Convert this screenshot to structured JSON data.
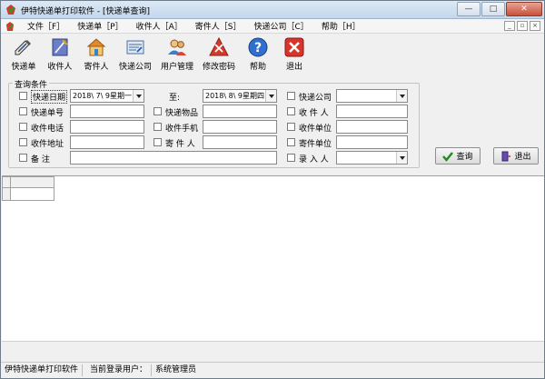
{
  "window": {
    "title": "伊特快递单打印软件 - [快递单查询]",
    "controls": [
      "—",
      "□",
      "✕"
    ]
  },
  "menu": {
    "items": [
      "文件［F］",
      "快递单［P］",
      "收件人［A］",
      "寄件人［S］",
      "快递公司［C］",
      "帮助［H］"
    ],
    "mdi_controls": [
      "_",
      "▫",
      "×"
    ]
  },
  "toolbar": {
    "items": [
      {
        "label": "快递单",
        "icon": "express-bill-icon"
      },
      {
        "label": "收件人",
        "icon": "recipient-icon"
      },
      {
        "label": "寄件人",
        "icon": "sender-house-icon"
      },
      {
        "label": "快递公司",
        "icon": "courier-company-icon"
      },
      {
        "label": "用户管理",
        "icon": "user-management-icon"
      },
      {
        "label": "修改密码",
        "icon": "change-password-icon"
      },
      {
        "label": "帮助",
        "icon": "help-icon"
      },
      {
        "label": "退出",
        "icon": "exit-icon"
      }
    ]
  },
  "query": {
    "group_title": "查询条件",
    "date_label": "快递日期",
    "date_from": "2018\\ 7\\ 9星期一",
    "to_label": "至:",
    "date_to": "2018\\ 8\\ 9星期四",
    "courier_label": "快递公司",
    "courier_value": "",
    "bill_no_label": "快递单号",
    "bill_no_value": "",
    "goods_label": "快递物品",
    "goods_value": "",
    "recipient_label": "收 件 人",
    "recipient_value": "",
    "recv_phone_label": "收件电话",
    "recv_phone_value": "",
    "recv_mobile_label": "收件手机",
    "recv_mobile_value": "",
    "recv_unit_label": "收件单位",
    "recv_unit_value": "",
    "recv_addr_label": "收件地址",
    "recv_addr_value": "",
    "sender_label": "寄 件 人",
    "sender_value": "",
    "send_unit_label": "寄件单位",
    "send_unit_value": "",
    "remark_label": "备    注",
    "remark_value": "",
    "entered_by_label": "录 入 人",
    "entered_by_value": ""
  },
  "buttons": {
    "search": "查询",
    "exit": "退出"
  },
  "status": {
    "app_name": "伊特快递单打印软件",
    "user_label": "当前登录用户：",
    "user_name": "系统管理员"
  },
  "colors": {
    "accent_red": "#c8503a",
    "check_green": "#1e8a1e"
  }
}
